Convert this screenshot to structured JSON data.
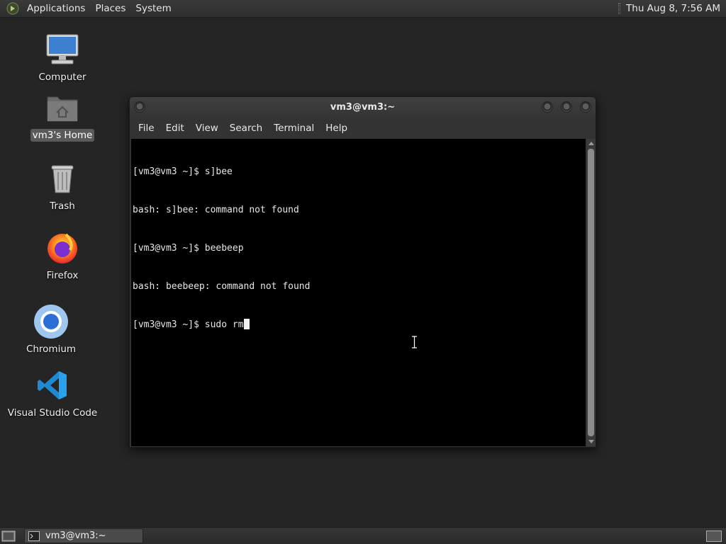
{
  "top_panel": {
    "menus": [
      "Applications",
      "Places",
      "System"
    ],
    "clock": "Thu Aug  8,  7:56 AM"
  },
  "desktop": {
    "icons": [
      {
        "label": "Computer",
        "icon": "computer-icon"
      },
      {
        "label": "vm3's Home",
        "icon": "home-folder-icon",
        "selected": true
      },
      {
        "label": "Trash",
        "icon": "trash-icon"
      },
      {
        "label": "Firefox",
        "icon": "firefox-icon"
      },
      {
        "label": "Chromium",
        "icon": "chromium-icon"
      },
      {
        "label": "Visual Studio Code",
        "icon": "vscode-icon"
      }
    ]
  },
  "terminal": {
    "title": "vm3@vm3:~",
    "menus": [
      "File",
      "Edit",
      "View",
      "Search",
      "Terminal",
      "Help"
    ],
    "lines": [
      "[vm3@vm3 ~]$ s]bee",
      "bash: s]bee: command not found",
      "[vm3@vm3 ~]$ beebeep",
      "bash: beebeep: command not found",
      "[vm3@vm3 ~]$ sudo rm"
    ]
  },
  "taskbar": {
    "task_label": "vm3@vm3:~"
  },
  "colors": {
    "desktop_bg": "#252525",
    "panel_bg": "#2e2e2e",
    "terminal_bg": "#000000",
    "terminal_fg": "#e6e6e6"
  }
}
